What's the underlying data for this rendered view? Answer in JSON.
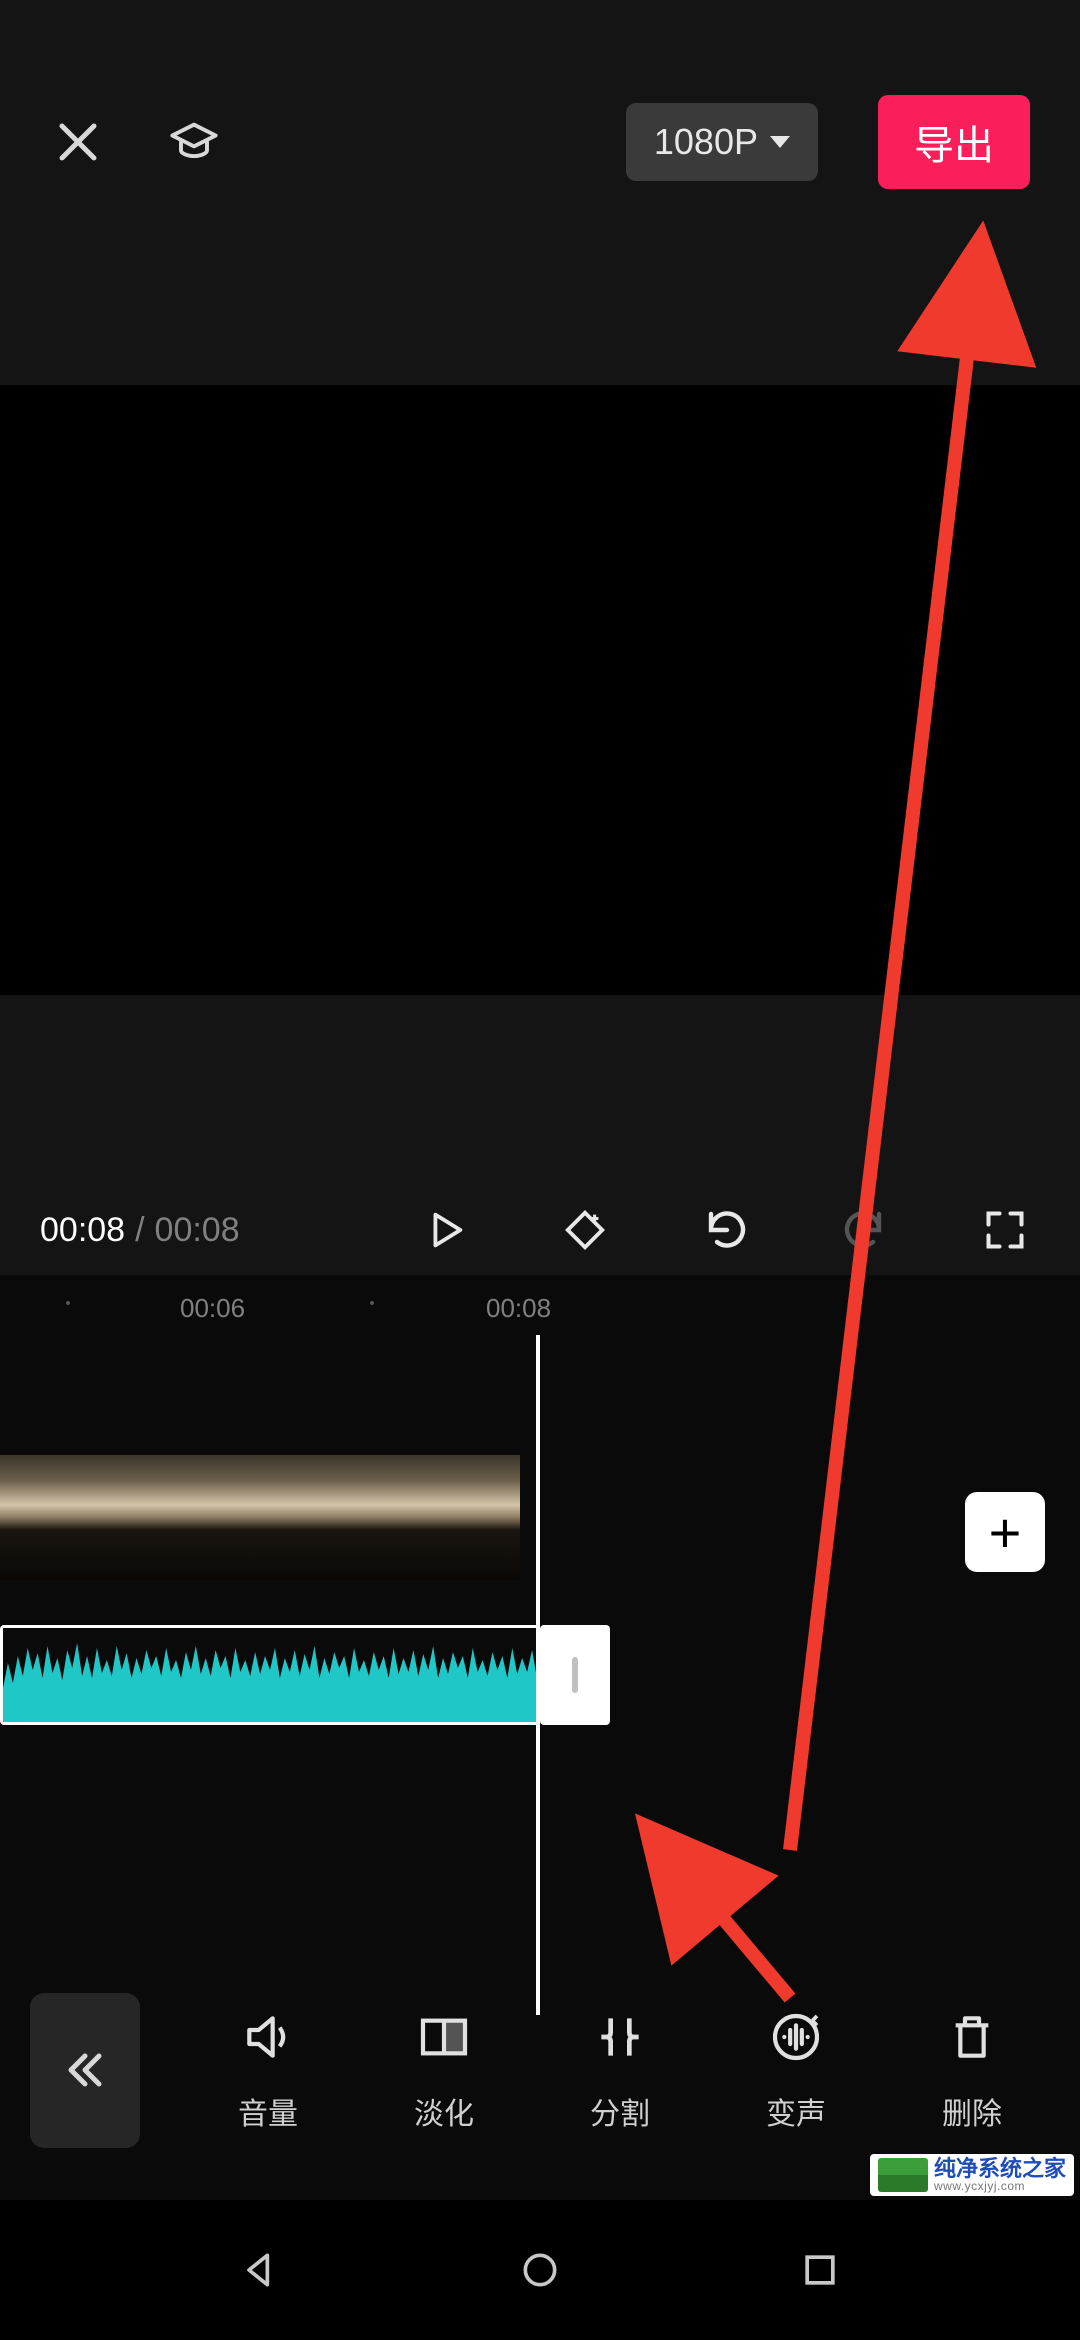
{
  "header": {
    "resolution_label": "1080P",
    "export_label": "导出"
  },
  "playback": {
    "current_time": "00:08",
    "separator": "/",
    "total_time": "00:08"
  },
  "timeline": {
    "ticks": [
      "00:06",
      "00:08"
    ]
  },
  "add_label": "+",
  "tools": [
    {
      "id": "volume",
      "label": "音量"
    },
    {
      "id": "fade",
      "label": "淡化"
    },
    {
      "id": "split",
      "label": "分割"
    },
    {
      "id": "voice",
      "label": "变声"
    },
    {
      "id": "delete",
      "label": "删除"
    }
  ],
  "watermark": {
    "brand": "纯净系统之家",
    "url": "www.ycxjyj.com"
  }
}
